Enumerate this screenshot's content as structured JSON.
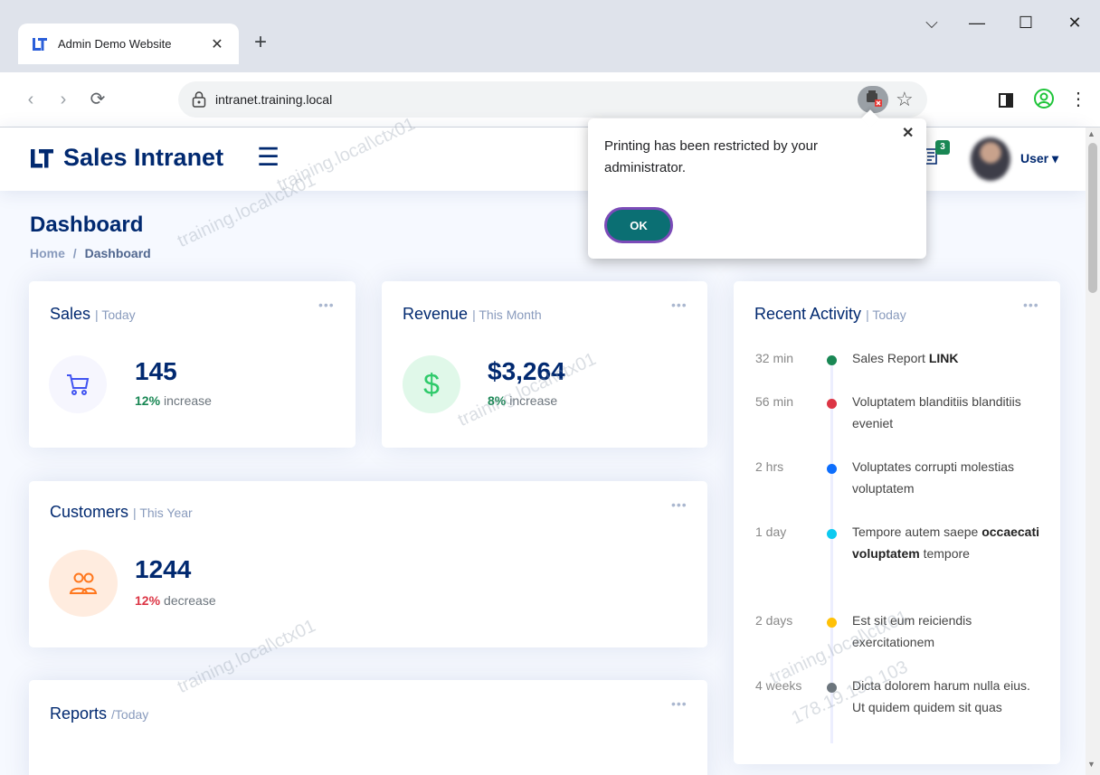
{
  "browser": {
    "tab_title": "Admin Demo Website",
    "tab_close": "✕",
    "new_tab": "+",
    "url": "intranet.training.local",
    "window_controls": [
      "⌵",
      "—",
      "☐",
      "✕"
    ]
  },
  "header": {
    "brand": "Sales Intranet",
    "notifications_count": "3",
    "user_label": "User ▾"
  },
  "page": {
    "title": "Dashboard",
    "breadcrumb_home": "Home",
    "breadcrumb_sep": "/",
    "breadcrumb_current": "Dashboard"
  },
  "cards": {
    "sales": {
      "title": "Sales",
      "period": "| Today",
      "value": "145",
      "pct": "12%",
      "trend": "increase",
      "trend_color": "#198754",
      "icon": "cart-icon"
    },
    "revenue": {
      "title": "Revenue",
      "period": "| This Month",
      "value": "$3,264",
      "pct": "8%",
      "trend": "increase",
      "trend_color": "#198754",
      "icon": "dollar-icon"
    },
    "customers": {
      "title": "Customers",
      "period": "| This Year",
      "value": "1244",
      "pct": "12%",
      "trend": "decrease",
      "trend_color": "#dc3545",
      "icon": "people-icon"
    },
    "reports": {
      "title": "Reports",
      "period": "/Today"
    },
    "menu_dots": "•••"
  },
  "activity": {
    "title": "Recent Activity",
    "period": "| Today",
    "items": [
      {
        "time": "32 min",
        "color": "#198754",
        "pre": "Sales Report ",
        "bold": "LINK",
        "post": ""
      },
      {
        "time": "56 min",
        "color": "#dc3545",
        "pre": "Voluptatem blanditiis blanditiis eveniet",
        "bold": "",
        "post": ""
      },
      {
        "time": "2 hrs",
        "color": "#0d6efd",
        "pre": "Voluptates corrupti molestias voluptatem",
        "bold": "",
        "post": ""
      },
      {
        "time": "1 day",
        "color": "#0dcaf0",
        "pre": "Tempore autem saepe ",
        "bold": "occaecati voluptatem",
        "post": " tempore"
      },
      {
        "time": "2 days",
        "color": "#ffc107",
        "pre": "Est sit eum reiciendis exercitationem",
        "bold": "",
        "post": ""
      },
      {
        "time": "4 weeks",
        "color": "#6c757d",
        "pre": "Dicta dolorem harum nulla eius. Ut quidem quidem sit quas",
        "bold": "",
        "post": ""
      }
    ]
  },
  "popup": {
    "message": "Printing has been restricted by your administrator.",
    "close": "✕",
    "ok_label": "OK"
  },
  "watermarks": {
    "host": "training.local\\ctx01",
    "ip": "178.19.152.103"
  }
}
